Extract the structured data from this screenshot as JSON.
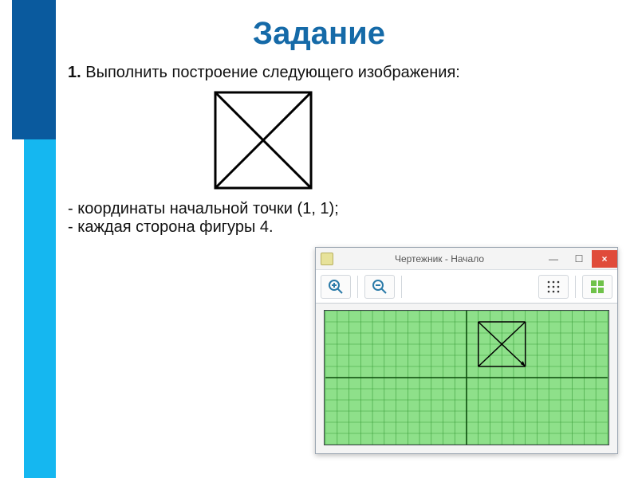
{
  "heading": "Задание",
  "task": {
    "number": "1.",
    "text": "Выполнить построение следующего изображения:"
  },
  "bullets": [
    "- координаты начальной точки (1, 1);",
    "- каждая сторона фигуры 4."
  ],
  "window": {
    "title": "Чертежник - Начало",
    "buttons": {
      "min": "—",
      "max": "☐",
      "close": "×"
    }
  },
  "icons": {
    "zoom_in": "zoom-in-icon",
    "zoom_out": "zoom-out-icon",
    "grid": "grid-icon",
    "home": "home-icon"
  },
  "chart_data": {
    "type": "line",
    "title": "Чертежник grid",
    "xlabel": "",
    "ylabel": "",
    "xlim": [
      -12,
      12
    ],
    "ylim": [
      -6,
      6
    ],
    "grid": true,
    "series": [
      {
        "name": "square-with-diagonals",
        "x": [
          1,
          5,
          5,
          1,
          1,
          5,
          1,
          5
        ],
        "y": [
          1,
          1,
          5,
          5,
          1,
          5,
          5,
          1
        ]
      }
    ],
    "start_point": [
      1,
      1
    ],
    "side": 4
  }
}
